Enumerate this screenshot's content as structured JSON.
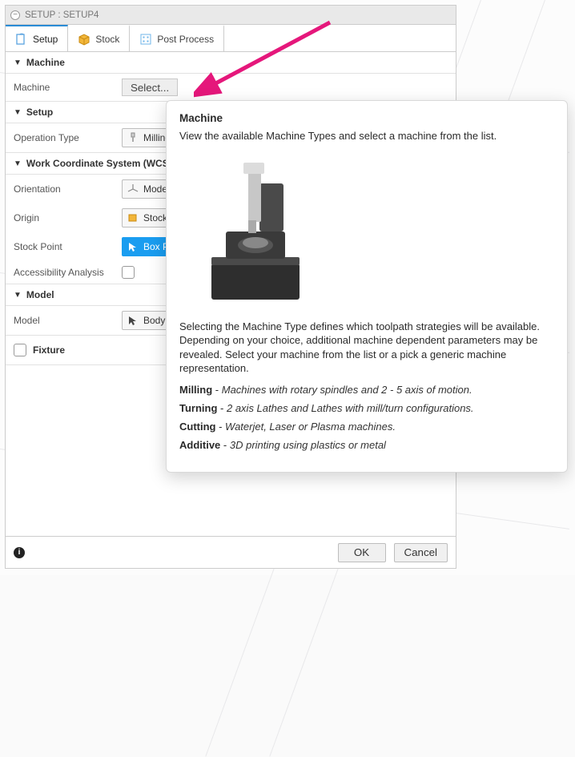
{
  "title": "SETUP : SETUP4",
  "tabs": [
    {
      "key": "setup",
      "label": "Setup",
      "active": true
    },
    {
      "key": "stock",
      "label": "Stock",
      "active": false
    },
    {
      "key": "post",
      "label": "Post Process",
      "active": false
    }
  ],
  "sections": {
    "machine": {
      "header": "Machine",
      "field_label": "Machine",
      "select_button": "Select..."
    },
    "setup": {
      "header": "Setup",
      "optype_label": "Operation Type",
      "optype_value": "Milling"
    },
    "wcs": {
      "header": "Work Coordinate System (WCS)",
      "orientation_label": "Orientation",
      "orientation_value": "Model",
      "origin_label": "Origin",
      "origin_value": "Stock",
      "stockpoint_label": "Stock Point",
      "stockpoint_value": "Box Po",
      "accessibility_label": "Accessibility Analysis"
    },
    "model": {
      "header": "Model",
      "model_label": "Model",
      "model_value": "Body"
    },
    "fixture": {
      "label": "Fixture"
    }
  },
  "footer": {
    "ok": "OK",
    "cancel": "Cancel"
  },
  "tooltip": {
    "title": "Machine",
    "intro": "View the available Machine Types and select a machine from the list.",
    "body": "Selecting the Machine Type defines which toolpath strategies will be available. Depending on your choice, additional machine dependent parameters may be revealed. Select your machine from the list or a pick a generic machine representation.",
    "defs": [
      {
        "term": "Milling",
        "desc": "Machines with rotary spindles and 2 - 5 axis of motion."
      },
      {
        "term": "Turning",
        "desc": "2 axis Lathes and Lathes with mill/turn configurations."
      },
      {
        "term": "Cutting",
        "desc": "Waterjet, Laser or Plasma machines."
      },
      {
        "term": "Additive",
        "desc": "3D printing using plastics or metal"
      }
    ]
  }
}
